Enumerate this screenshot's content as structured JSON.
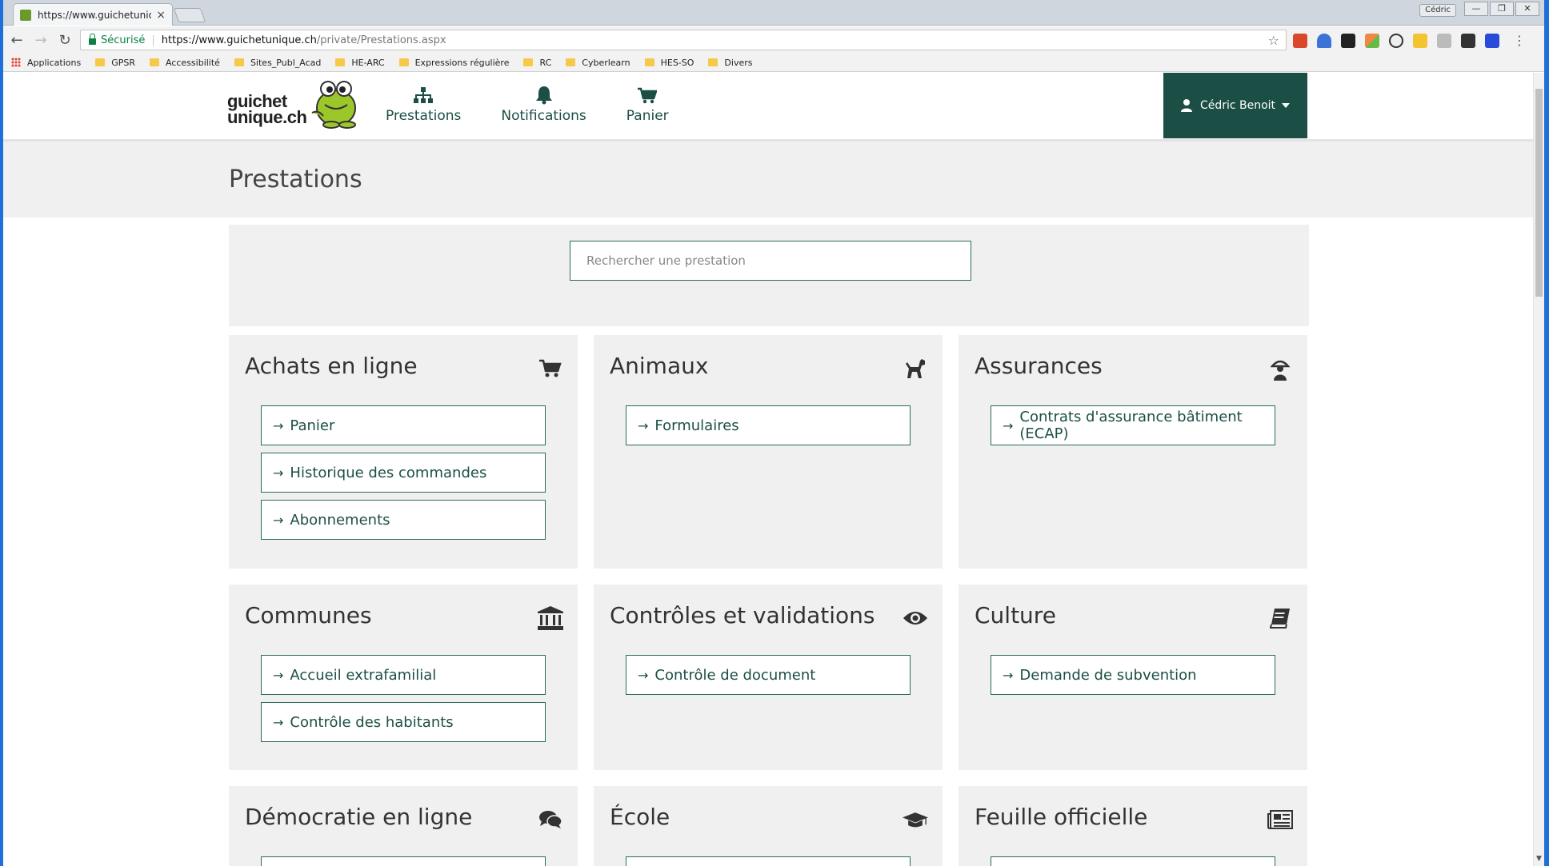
{
  "browser": {
    "tab_title": "https://www.guichetuniq",
    "tab_close": "×",
    "window_user": "Cédric",
    "window_controls": [
      "—",
      "❐",
      "✕"
    ],
    "secure_label": "Sécurisé",
    "url_host": "https://www.guichetunique.ch",
    "url_path": "/private/Prestations.aspx",
    "bookmarks": [
      "Applications",
      "GPSR",
      "Accessibilité",
      "Sites_Publ_Acad",
      "HE-ARC",
      "Expressions régulière",
      "RC",
      "Cyberlearn",
      "HES-SO",
      "Divers"
    ]
  },
  "site": {
    "nav": [
      {
        "label": "Prestations",
        "icon": "sitemap-icon"
      },
      {
        "label": "Notifications",
        "icon": "bell-icon"
      },
      {
        "label": "Panier",
        "icon": "cart-icon"
      }
    ],
    "user_name": "Cédric Benoit"
  },
  "page": {
    "title": "Prestations",
    "search_placeholder": "Rechercher une prestation"
  },
  "categories": [
    {
      "title": "Achats en ligne",
      "icon": "cart-icon",
      "links": [
        "Panier",
        "Historique des commandes",
        "Abonnements"
      ]
    },
    {
      "title": "Animaux",
      "icon": "dog-icon",
      "links": [
        "Formulaires"
      ]
    },
    {
      "title": "Assurances",
      "icon": "umbrella-person-icon",
      "links": [
        "Contrats d'assurance bâtiment (ECAP)"
      ]
    },
    {
      "title": "Communes",
      "icon": "institution-icon",
      "links": [
        "Accueil extrafamilial",
        "Contrôle des habitants"
      ]
    },
    {
      "title": "Contrôles et validations",
      "icon": "eye-icon",
      "links": [
        "Contrôle de document"
      ]
    },
    {
      "title": "Culture",
      "icon": "book-icon",
      "links": [
        "Demande de subvention"
      ]
    },
    {
      "title": "Démocratie en ligne",
      "icon": "comments-icon",
      "links": []
    },
    {
      "title": "École",
      "icon": "graduation-cap-icon",
      "links": []
    },
    {
      "title": "Feuille officielle",
      "icon": "newspaper-icon",
      "links": []
    }
  ],
  "colors": {
    "brand_dark_green": "#1b4f45",
    "panel_gray": "#f0f0f0",
    "logo_green": "#9cc72b"
  }
}
